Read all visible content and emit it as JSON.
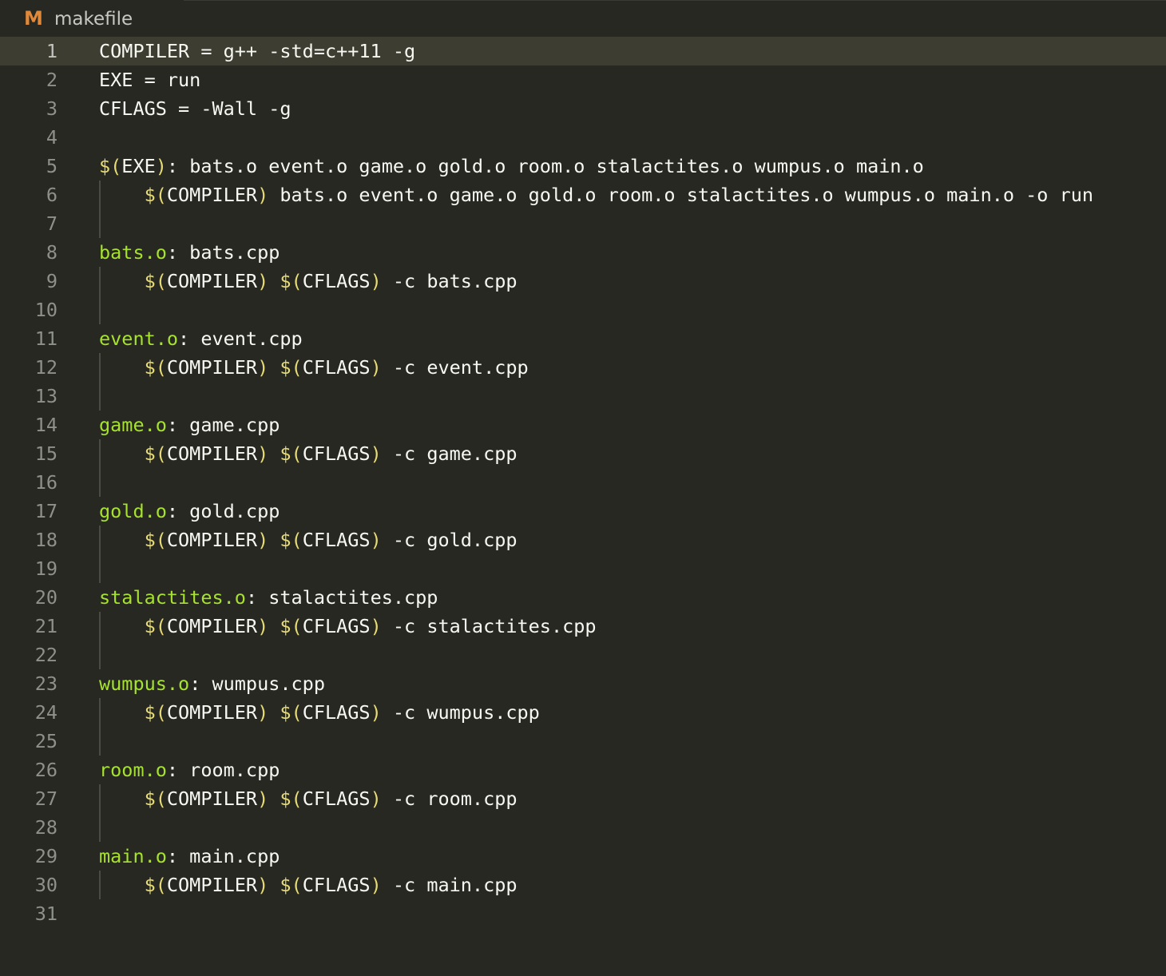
{
  "tab": {
    "icon": "makefile-m-icon",
    "icon_glyph": "M",
    "filename": "makefile"
  },
  "colors": {
    "background": "#272822",
    "current_line": "#3e3d32",
    "plain": "#f8f8f2",
    "target": "#a6e22e",
    "variable": "#e6db74",
    "line_number": "#8f908a",
    "icon": "#e0893a"
  },
  "current_line": 1,
  "lines": [
    {
      "num": "1",
      "indent": false,
      "tokens": [
        {
          "t": "COMPILER = g++ -std=c++11 -g",
          "k": "plain"
        }
      ]
    },
    {
      "num": "2",
      "indent": false,
      "tokens": [
        {
          "t": "EXE = run",
          "k": "plain"
        }
      ]
    },
    {
      "num": "3",
      "indent": false,
      "tokens": [
        {
          "t": "CFLAGS = -Wall -g",
          "k": "plain"
        }
      ]
    },
    {
      "num": "4",
      "indent": false,
      "tokens": []
    },
    {
      "num": "5",
      "indent": false,
      "tokens": [
        {
          "t": "$(",
          "k": "var"
        },
        {
          "t": "EXE",
          "k": "plain"
        },
        {
          "t": ")",
          "k": "var"
        },
        {
          "t": ": bats.o event.o game.o gold.o room.o stalactites.o wumpus.o main.o",
          "k": "plain"
        }
      ]
    },
    {
      "num": "6",
      "indent": true,
      "tokens": [
        {
          "t": "    ",
          "k": "plain"
        },
        {
          "t": "$(",
          "k": "var"
        },
        {
          "t": "COMPILER",
          "k": "plain"
        },
        {
          "t": ")",
          "k": "var"
        },
        {
          "t": " bats.o event.o game.o gold.o room.o stalactites.o wumpus.o main.o -o run",
          "k": "plain"
        }
      ]
    },
    {
      "num": "7",
      "indent": true,
      "tokens": []
    },
    {
      "num": "8",
      "indent": false,
      "tokens": [
        {
          "t": "bats.o",
          "k": "target"
        },
        {
          "t": ": bats.cpp",
          "k": "plain"
        }
      ]
    },
    {
      "num": "9",
      "indent": true,
      "tokens": [
        {
          "t": "    ",
          "k": "plain"
        },
        {
          "t": "$(",
          "k": "var"
        },
        {
          "t": "COMPILER",
          "k": "plain"
        },
        {
          "t": ")",
          "k": "var"
        },
        {
          "t": " ",
          "k": "plain"
        },
        {
          "t": "$(",
          "k": "var"
        },
        {
          "t": "CFLAGS",
          "k": "plain"
        },
        {
          "t": ")",
          "k": "var"
        },
        {
          "t": " -c bats.cpp",
          "k": "plain"
        }
      ]
    },
    {
      "num": "10",
      "indent": true,
      "tokens": []
    },
    {
      "num": "11",
      "indent": false,
      "tokens": [
        {
          "t": "event.o",
          "k": "target"
        },
        {
          "t": ": event.cpp",
          "k": "plain"
        }
      ]
    },
    {
      "num": "12",
      "indent": true,
      "tokens": [
        {
          "t": "    ",
          "k": "plain"
        },
        {
          "t": "$(",
          "k": "var"
        },
        {
          "t": "COMPILER",
          "k": "plain"
        },
        {
          "t": ")",
          "k": "var"
        },
        {
          "t": " ",
          "k": "plain"
        },
        {
          "t": "$(",
          "k": "var"
        },
        {
          "t": "CFLAGS",
          "k": "plain"
        },
        {
          "t": ")",
          "k": "var"
        },
        {
          "t": " -c event.cpp",
          "k": "plain"
        }
      ]
    },
    {
      "num": "13",
      "indent": true,
      "tokens": []
    },
    {
      "num": "14",
      "indent": false,
      "tokens": [
        {
          "t": "game.o",
          "k": "target"
        },
        {
          "t": ": game.cpp",
          "k": "plain"
        }
      ]
    },
    {
      "num": "15",
      "indent": true,
      "tokens": [
        {
          "t": "    ",
          "k": "plain"
        },
        {
          "t": "$(",
          "k": "var"
        },
        {
          "t": "COMPILER",
          "k": "plain"
        },
        {
          "t": ")",
          "k": "var"
        },
        {
          "t": " ",
          "k": "plain"
        },
        {
          "t": "$(",
          "k": "var"
        },
        {
          "t": "CFLAGS",
          "k": "plain"
        },
        {
          "t": ")",
          "k": "var"
        },
        {
          "t": " -c game.cpp",
          "k": "plain"
        }
      ]
    },
    {
      "num": "16",
      "indent": true,
      "tokens": []
    },
    {
      "num": "17",
      "indent": false,
      "tokens": [
        {
          "t": "gold.o",
          "k": "target"
        },
        {
          "t": ": gold.cpp",
          "k": "plain"
        }
      ]
    },
    {
      "num": "18",
      "indent": true,
      "tokens": [
        {
          "t": "    ",
          "k": "plain"
        },
        {
          "t": "$(",
          "k": "var"
        },
        {
          "t": "COMPILER",
          "k": "plain"
        },
        {
          "t": ")",
          "k": "var"
        },
        {
          "t": " ",
          "k": "plain"
        },
        {
          "t": "$(",
          "k": "var"
        },
        {
          "t": "CFLAGS",
          "k": "plain"
        },
        {
          "t": ")",
          "k": "var"
        },
        {
          "t": " -c gold.cpp",
          "k": "plain"
        }
      ]
    },
    {
      "num": "19",
      "indent": true,
      "tokens": []
    },
    {
      "num": "20",
      "indent": false,
      "tokens": [
        {
          "t": "stalactites.o",
          "k": "target"
        },
        {
          "t": ": stalactites.cpp",
          "k": "plain"
        }
      ]
    },
    {
      "num": "21",
      "indent": true,
      "tokens": [
        {
          "t": "    ",
          "k": "plain"
        },
        {
          "t": "$(",
          "k": "var"
        },
        {
          "t": "COMPILER",
          "k": "plain"
        },
        {
          "t": ")",
          "k": "var"
        },
        {
          "t": " ",
          "k": "plain"
        },
        {
          "t": "$(",
          "k": "var"
        },
        {
          "t": "CFLAGS",
          "k": "plain"
        },
        {
          "t": ")",
          "k": "var"
        },
        {
          "t": " -c stalactites.cpp",
          "k": "plain"
        }
      ]
    },
    {
      "num": "22",
      "indent": true,
      "tokens": []
    },
    {
      "num": "23",
      "indent": false,
      "tokens": [
        {
          "t": "wumpus.o",
          "k": "target"
        },
        {
          "t": ": wumpus.cpp",
          "k": "plain"
        }
      ]
    },
    {
      "num": "24",
      "indent": true,
      "tokens": [
        {
          "t": "    ",
          "k": "plain"
        },
        {
          "t": "$(",
          "k": "var"
        },
        {
          "t": "COMPILER",
          "k": "plain"
        },
        {
          "t": ")",
          "k": "var"
        },
        {
          "t": " ",
          "k": "plain"
        },
        {
          "t": "$(",
          "k": "var"
        },
        {
          "t": "CFLAGS",
          "k": "plain"
        },
        {
          "t": ")",
          "k": "var"
        },
        {
          "t": " -c wumpus.cpp",
          "k": "plain"
        }
      ]
    },
    {
      "num": "25",
      "indent": true,
      "tokens": []
    },
    {
      "num": "26",
      "indent": false,
      "tokens": [
        {
          "t": "room.o",
          "k": "target"
        },
        {
          "t": ": room.cpp",
          "k": "plain"
        }
      ]
    },
    {
      "num": "27",
      "indent": true,
      "tokens": [
        {
          "t": "    ",
          "k": "plain"
        },
        {
          "t": "$(",
          "k": "var"
        },
        {
          "t": "COMPILER",
          "k": "plain"
        },
        {
          "t": ")",
          "k": "var"
        },
        {
          "t": " ",
          "k": "plain"
        },
        {
          "t": "$(",
          "k": "var"
        },
        {
          "t": "CFLAGS",
          "k": "plain"
        },
        {
          "t": ")",
          "k": "var"
        },
        {
          "t": " -c room.cpp",
          "k": "plain"
        }
      ]
    },
    {
      "num": "28",
      "indent": true,
      "tokens": []
    },
    {
      "num": "29",
      "indent": false,
      "tokens": [
        {
          "t": "main.o",
          "k": "target"
        },
        {
          "t": ": main.cpp",
          "k": "plain"
        }
      ]
    },
    {
      "num": "30",
      "indent": true,
      "tokens": [
        {
          "t": "    ",
          "k": "plain"
        },
        {
          "t": "$(",
          "k": "var"
        },
        {
          "t": "COMPILER",
          "k": "plain"
        },
        {
          "t": ")",
          "k": "var"
        },
        {
          "t": " ",
          "k": "plain"
        },
        {
          "t": "$(",
          "k": "var"
        },
        {
          "t": "CFLAGS",
          "k": "plain"
        },
        {
          "t": ")",
          "k": "var"
        },
        {
          "t": " -c main.cpp",
          "k": "plain"
        }
      ]
    },
    {
      "num": "31",
      "indent": false,
      "tokens": []
    }
  ]
}
